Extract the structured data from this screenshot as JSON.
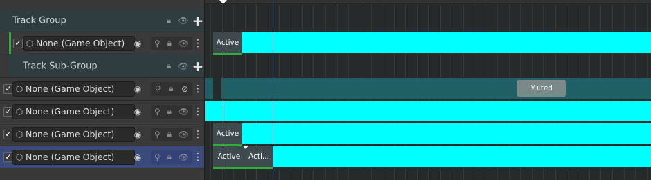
{
  "track_group": {
    "title": "Track Group",
    "lock_icon": "lock-icon",
    "eye_icon": "eye-icon",
    "add_icon": "plus-icon"
  },
  "sub_group": {
    "title": "Track Sub-Group"
  },
  "tracks": [
    {
      "checked": true,
      "object_field": "None (Game Object)",
      "clip_label": "Active",
      "colors": {
        "accent": "#00ffff"
      }
    },
    {
      "checked": true,
      "object_field": "None (Game Object)",
      "muted_label": "Muted"
    },
    {
      "checked": true,
      "object_field": "None (Game Object)"
    },
    {
      "checked": true,
      "object_field": "None (Game Object)",
      "clip_label": "Active"
    },
    {
      "checked": true,
      "object_field": "None (Game Object)",
      "clip_label_1": "Active",
      "clip_label_2": "Acti..."
    }
  ],
  "colors": {
    "accent": "#00ffff",
    "selected_row": "#3a4a7a",
    "active_underline": "#2fae3c"
  }
}
